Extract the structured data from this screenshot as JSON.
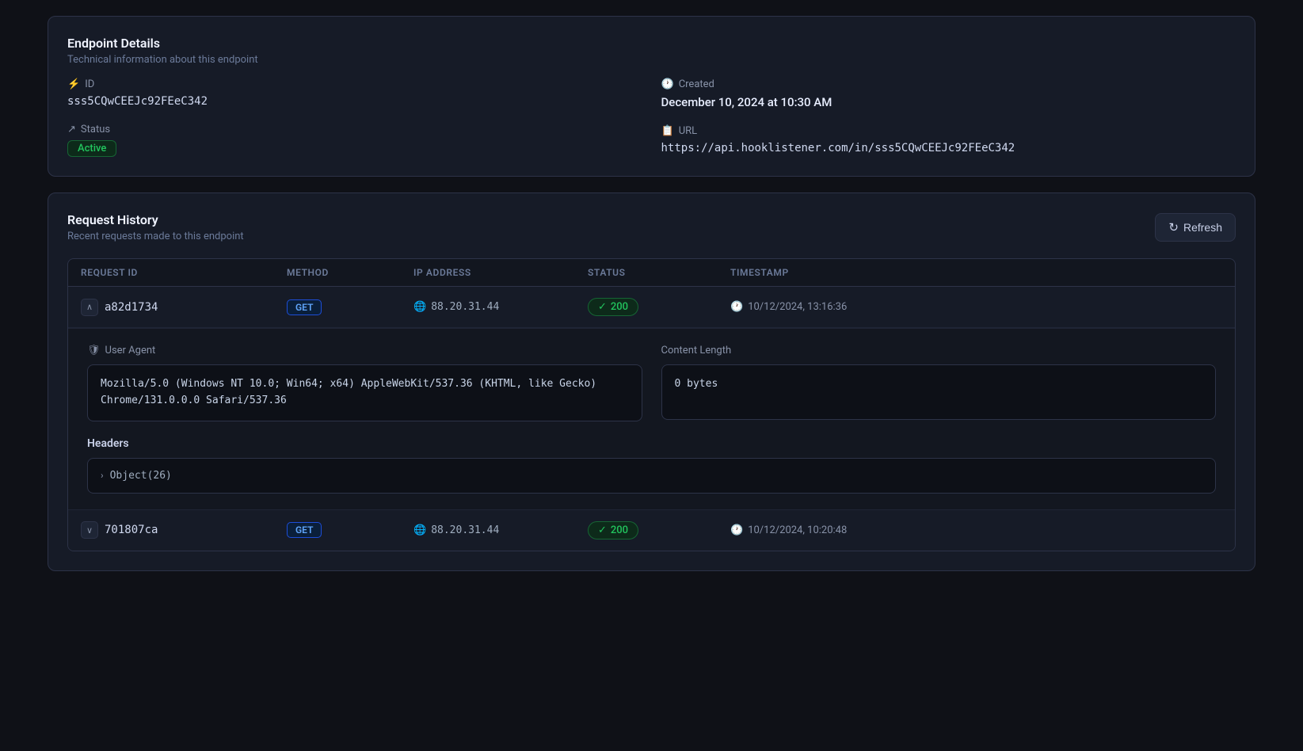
{
  "endpoint_details": {
    "title": "Endpoint Details",
    "subtitle": "Technical information about this endpoint",
    "id_label": "ID",
    "id_value": "sss5CQwCEEJc92FEeC342",
    "created_label": "Created",
    "created_value": "December 10, 2024 at 10:30 AM",
    "status_label": "Status",
    "status_value": "Active",
    "url_label": "URL",
    "url_value": "https://api.hooklistener.com/in/sss5CQwCEEJc92FEeC342"
  },
  "request_history": {
    "title": "Request History",
    "subtitle": "Recent requests made to this endpoint",
    "refresh_label": "Refresh",
    "table": {
      "headers": [
        "Request ID",
        "Method",
        "IP Address",
        "Status",
        "Timestamp"
      ],
      "rows": [
        {
          "id": "a82d1734",
          "method": "GET",
          "ip": "88.20.31.44",
          "status": "200",
          "timestamp": "10/12/2024, 13:16:36",
          "expanded": true,
          "user_agent": "Mozilla/5.0 (Windows NT 10.0; Win64; x64) AppleWebKit/537.36 (KHTML, like Gecko) Chrome/131.0.0.0 Safari/537.36",
          "content_length": "0 bytes",
          "headers_label": "Headers",
          "headers_value": "Object(26)"
        },
        {
          "id": "701807ca",
          "method": "GET",
          "ip": "88.20.31.44",
          "status": "200",
          "timestamp": "10/12/2024, 10:20:48",
          "expanded": false
        }
      ]
    }
  },
  "icons": {
    "id": "⚡",
    "created": "🕐",
    "status": "↗",
    "url": "📋",
    "globe": "🌐",
    "check": "✓",
    "clock": "🕐",
    "shield": "🛡",
    "refresh": "↻",
    "chevron_up": "∧",
    "chevron_down": "∨",
    "chevron_right": "›"
  }
}
